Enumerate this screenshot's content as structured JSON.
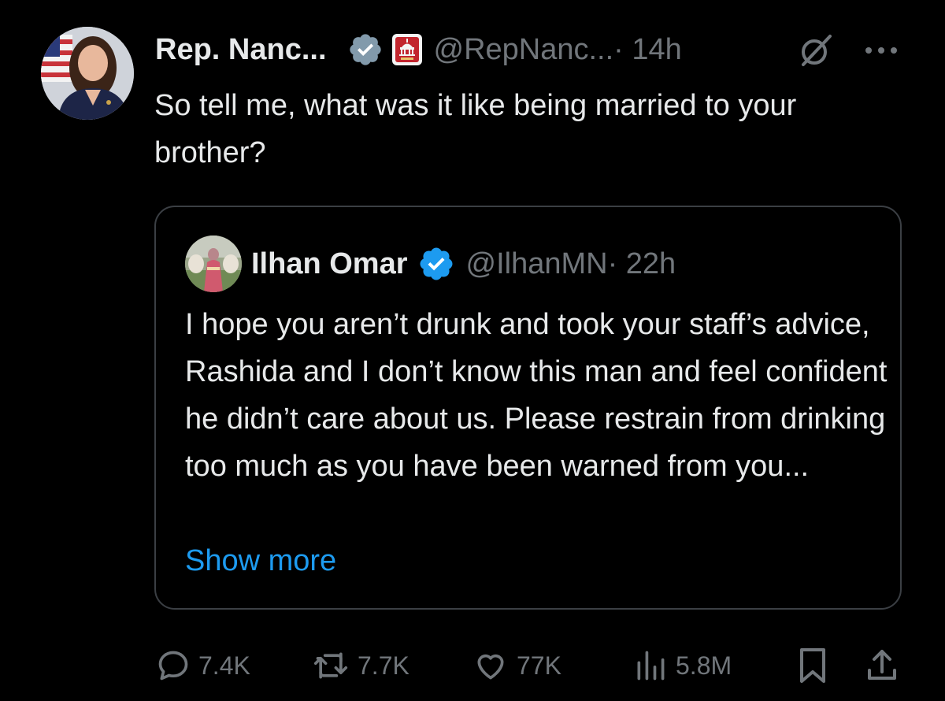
{
  "tweet": {
    "author_name": "Rep. Nanc...",
    "handle": "@RepNanc...",
    "time": " · 14h",
    "text": "So tell me, what was it like being married to your brother?",
    "icons": {
      "verified": "verified-badge-icon",
      "affiliate": "gop-capitol-affiliate-icon",
      "grok": "grok-icon",
      "more": "more-dots-icon"
    }
  },
  "quoted_tweet": {
    "author_name": "Ilhan Omar",
    "handle": "@IlhanMN",
    "time": " · 22h",
    "text": "I hope you aren’t drunk and took your staff’s advice, Rashida and I don’t know this man and feel confident he didn’t care about us. Please restrain from drinking too much as you have been warned from you...",
    "show_more": "Show more"
  },
  "actions": {
    "replies": "7.4K",
    "reposts": "7.7K",
    "likes": "77K",
    "views": "5.8M"
  },
  "colors": {
    "background": "#000000",
    "text": "#e7e9ea",
    "muted": "#71767b",
    "link": "#1d9bf0",
    "verified_gray": "#829aab",
    "verified_blue": "#1d9bf0",
    "card_border": "#3b3f44"
  }
}
